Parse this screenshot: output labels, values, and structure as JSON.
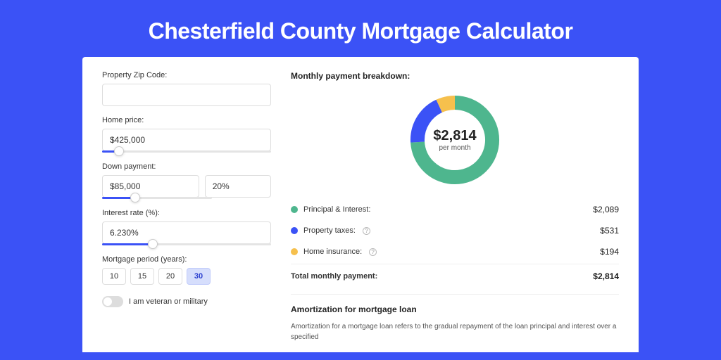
{
  "title": "Chesterfield County Mortgage Calculator",
  "form": {
    "zip_label": "Property Zip Code:",
    "zip_value": "",
    "home_price_label": "Home price:",
    "home_price_value": "$425,000",
    "down_payment_label": "Down payment:",
    "down_payment_value": "$85,000",
    "down_payment_pct": "20%",
    "interest_label": "Interest rate (%):",
    "interest_value": "6.230%",
    "period_label": "Mortgage period (years):",
    "periods": [
      "10",
      "15",
      "20",
      "30"
    ],
    "period_active_index": 3,
    "veteran_label": "I am veteran or military",
    "sliders": {
      "home_price_pct": 10,
      "down_payment_pct": 20,
      "interest_pct": 30
    }
  },
  "breakdown": {
    "title": "Monthly payment breakdown:",
    "total": "$2,814",
    "total_sub": "per month",
    "items": [
      {
        "label": "Principal & Interest:",
        "value": "$2,089",
        "color": "#4eb68e",
        "pct": 74,
        "info": false
      },
      {
        "label": "Property taxes:",
        "value": "$531",
        "color": "#3b52f6",
        "pct": 19,
        "info": true
      },
      {
        "label": "Home insurance:",
        "value": "$194",
        "color": "#f6c04d",
        "pct": 7,
        "info": true
      }
    ],
    "total_row_label": "Total monthly payment:",
    "total_row_value": "$2,814"
  },
  "amortization": {
    "title": "Amortization for mortgage loan",
    "text": "Amortization for a mortgage loan refers to the gradual repayment of the loan principal and interest over a specified"
  },
  "chart_data": {
    "type": "pie",
    "title": "Monthly payment breakdown",
    "categories": [
      "Principal & Interest",
      "Property taxes",
      "Home insurance"
    ],
    "values": [
      2089,
      531,
      194
    ],
    "colors": [
      "#4eb68e",
      "#3b52f6",
      "#f6c04d"
    ],
    "total": 2814,
    "unit": "USD per month"
  }
}
